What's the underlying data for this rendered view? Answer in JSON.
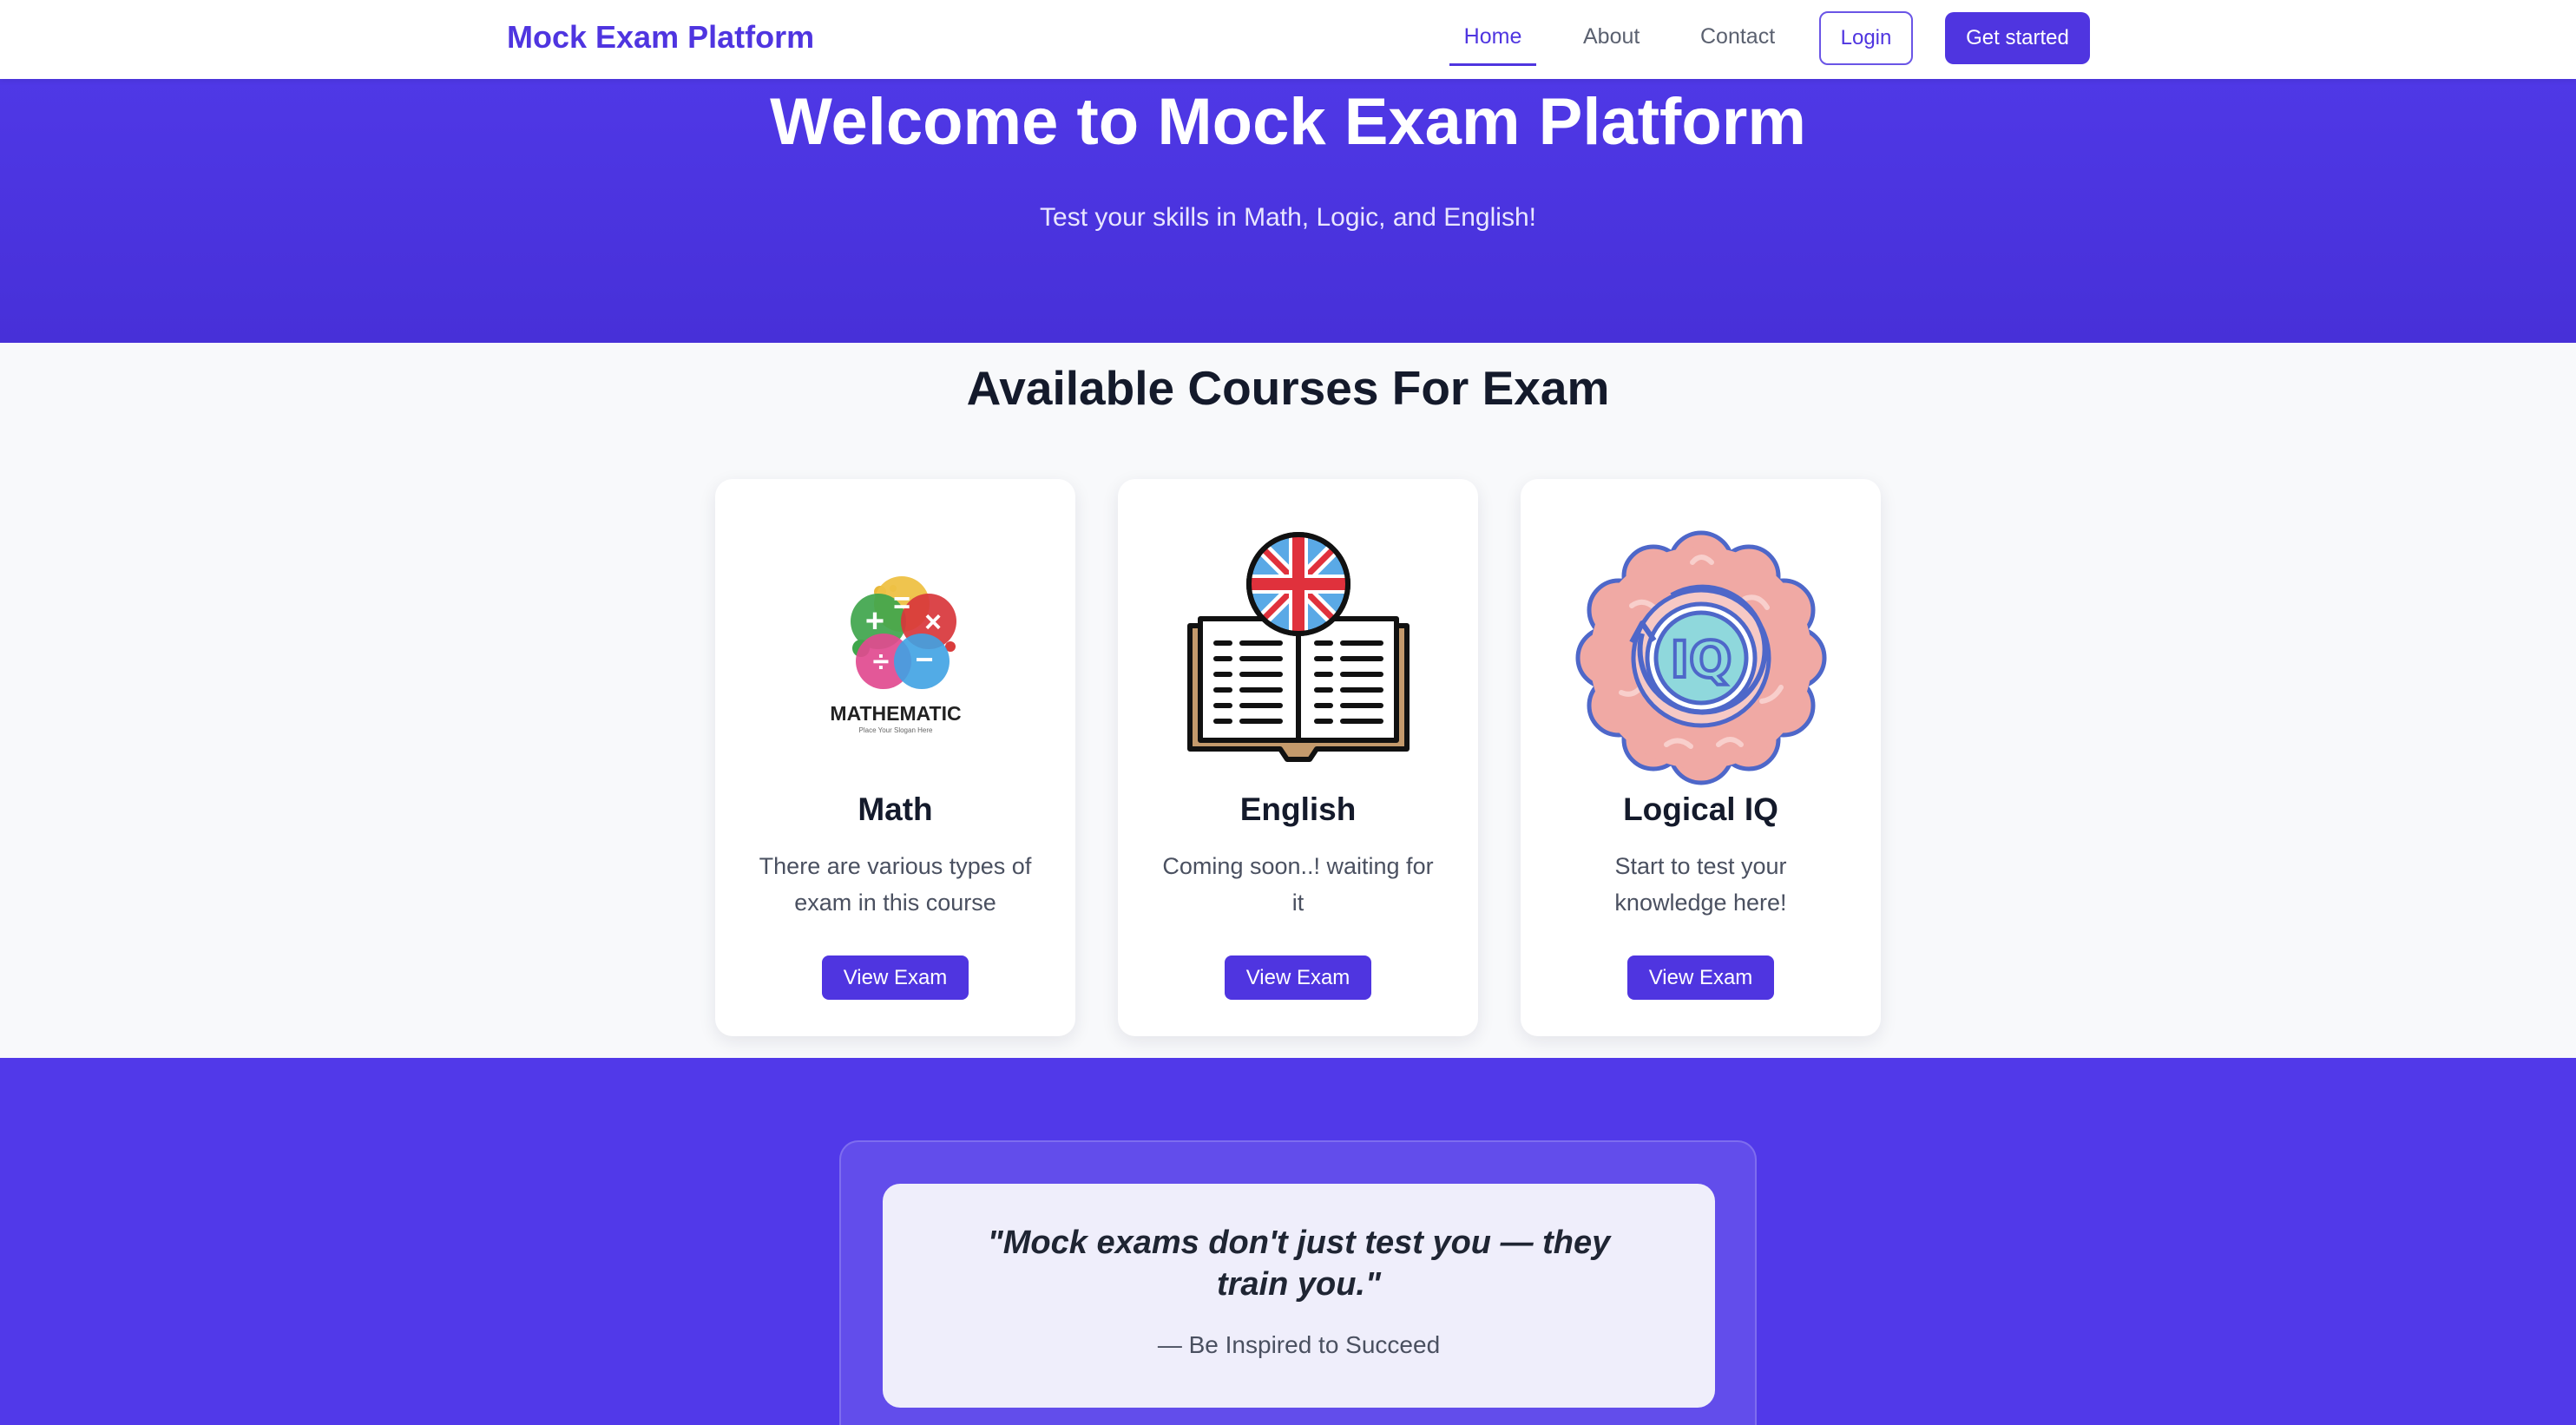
{
  "nav": {
    "brand": "Mock Exam Platform",
    "links": [
      "Home",
      "About",
      "Contact"
    ],
    "login": "Login",
    "get_started": "Get started"
  },
  "hero": {
    "title": "Welcome to Mock Exam Platform",
    "subtitle": "Test your skills in Math, Logic, and English!"
  },
  "courses": {
    "title": "Available Courses For Exam",
    "items": [
      {
        "name": "Math",
        "description": "There are various types of exam in this course",
        "button": "View Exam",
        "icon": "mathematic-logo",
        "logo_text": "MATHEMATIC",
        "logo_slogan": "Place Your Slogan Here"
      },
      {
        "name": "English",
        "description": "Coming soon..! waiting for it",
        "button": "View Exam",
        "icon": "book-uk-flag-icon"
      },
      {
        "name": "Logical IQ",
        "description": "Start to test your knowledge here!",
        "button": "View Exam",
        "icon": "brain-iq-icon",
        "icon_text": "IQ"
      }
    ]
  },
  "quote": {
    "text": "\"Mock exams don't just test you — they train you.\"",
    "author": "— Be Inspired to Succeed"
  },
  "colors": {
    "accent": "#4f35e0",
    "hero": "#4a33df",
    "quote_band": "#5139e9"
  }
}
